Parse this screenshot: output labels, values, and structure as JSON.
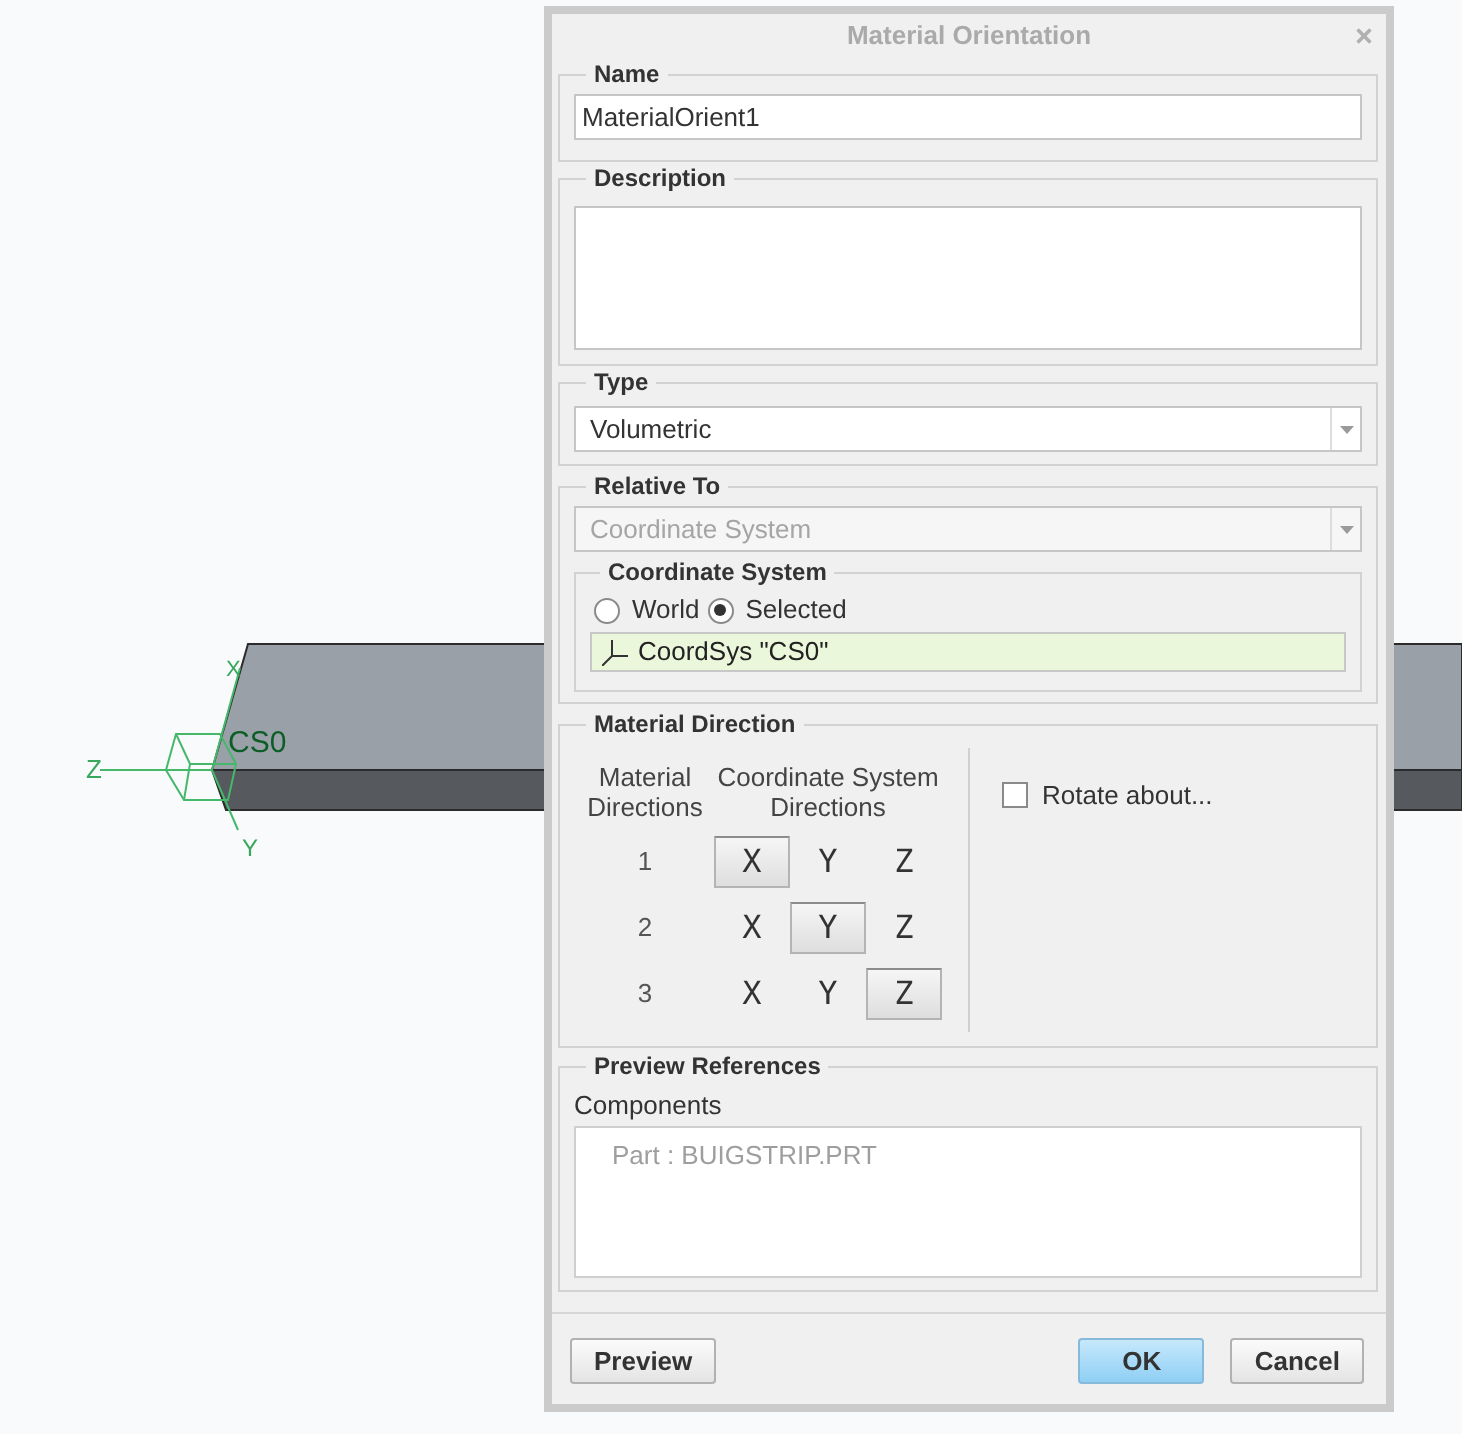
{
  "viewport": {
    "coordinate_system": {
      "name": "CS0",
      "axis_labels": [
        "X",
        "Z",
        "Y"
      ]
    }
  },
  "dialog": {
    "title": "Material Orientation",
    "name": {
      "label": "Name",
      "value": "MaterialOrient1"
    },
    "description": {
      "label": "Description"
    },
    "type": {
      "label": "Type",
      "value": "Volumetric"
    },
    "relative_to": {
      "label": "Relative To",
      "value": "Coordinate System",
      "disabled": true,
      "coordinate_system": {
        "label": "Coordinate System",
        "options": [
          {
            "label": "World",
            "selected": false
          },
          {
            "label": "Selected",
            "selected": true
          }
        ],
        "reference": "CoordSys \"CS0\""
      }
    },
    "material_direction": {
      "label": "Material Direction",
      "columns": [
        "Material Directions",
        "Coordinate System Directions"
      ],
      "rows": [
        {
          "number": "1",
          "axes": [
            {
              "label": "X",
              "selected": true
            },
            {
              "label": "Y",
              "selected": false
            },
            {
              "label": "Z",
              "selected": false
            }
          ]
        },
        {
          "number": "2",
          "axes": [
            {
              "label": "X",
              "selected": false
            },
            {
              "label": "Y",
              "selected": true
            },
            {
              "label": "Z",
              "selected": false
            }
          ]
        },
        {
          "number": "3",
          "axes": [
            {
              "label": "X",
              "selected": false
            },
            {
              "label": "Y",
              "selected": false
            },
            {
              "label": "Z",
              "selected": true
            }
          ]
        }
      ],
      "rotate_about": {
        "label": "Rotate about...",
        "checked": false
      }
    },
    "preview_references": {
      "label": "Preview References",
      "components": {
        "label": "Components",
        "items": [
          {
            "label": "Part : BUIGSTRIP.PRT",
            "disabled": true
          }
        ]
      }
    },
    "buttons": [
      {
        "label": "Preview",
        "kind": "default"
      },
      {
        "label": "OK",
        "kind": "primary"
      },
      {
        "label": "Cancel",
        "kind": "default"
      }
    ]
  }
}
